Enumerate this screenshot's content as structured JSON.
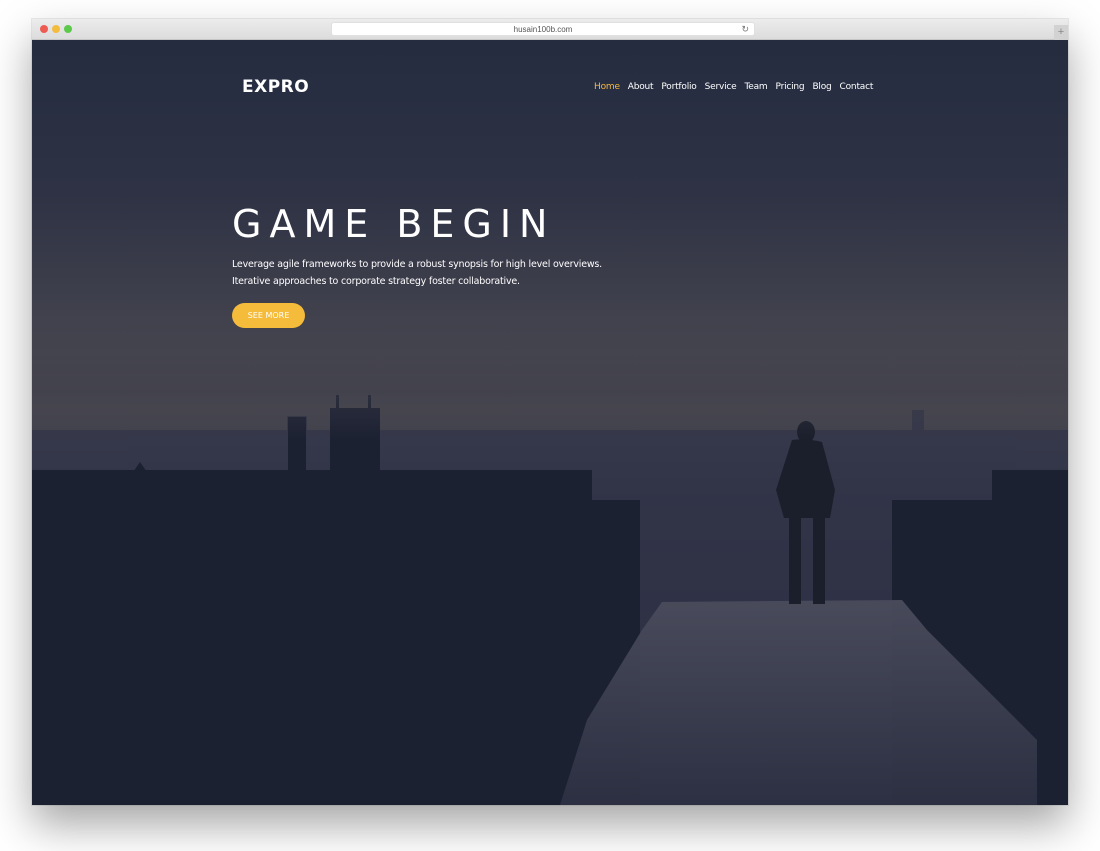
{
  "browser": {
    "url": "husain100b.com",
    "reload_icon": "reload-icon",
    "new_tab_icon": "plus-icon"
  },
  "site": {
    "logo": "EXPRO",
    "nav": [
      {
        "label": "Home",
        "active": true
      },
      {
        "label": "About",
        "active": false
      },
      {
        "label": "Portfolio",
        "active": false
      },
      {
        "label": "Service",
        "active": false
      },
      {
        "label": "Team",
        "active": false
      },
      {
        "label": "Pricing",
        "active": false
      },
      {
        "label": "Blog",
        "active": false
      },
      {
        "label": "Contact",
        "active": false
      }
    ],
    "hero": {
      "title": "GAME BEGIN",
      "line1": "Leverage agile frameworks to provide a robust synopsis for high level overviews.",
      "line2": "Iterative approaches to corporate strategy foster collaborative.",
      "cta": "SEE MORE"
    },
    "background_image": "city-skyline-person-on-rooftop",
    "colors": {
      "accent": "#f5bb3b",
      "overlay": "#1f2436",
      "text": "#ffffff"
    }
  }
}
